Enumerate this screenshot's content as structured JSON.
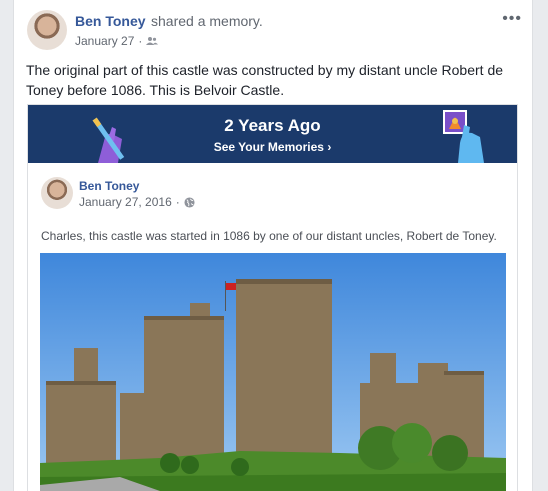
{
  "post": {
    "author": "Ben Toney",
    "action": "shared a memory.",
    "date": "January 27",
    "separator": "·",
    "privacy_icon": "friends-icon",
    "more_label": "•••",
    "text": "The original part of this castle was constructed by my distant uncle Robert de Toney before 1086. This is Belvoir Castle."
  },
  "memory": {
    "title": "2 Years Ago",
    "link": "See Your Memories",
    "chevron": "›"
  },
  "original": {
    "author": "Ben Toney",
    "date": "January 27, 2016",
    "separator": "·",
    "privacy_icon": "globe-icon",
    "text": "Charles, this castle was started in 1086 by one of our distant uncles, Robert de Toney."
  },
  "colors": {
    "link": "#365899",
    "banner": "#1b3a6b",
    "sky": "#5b9fe0",
    "grass": "#4c8a2a"
  }
}
